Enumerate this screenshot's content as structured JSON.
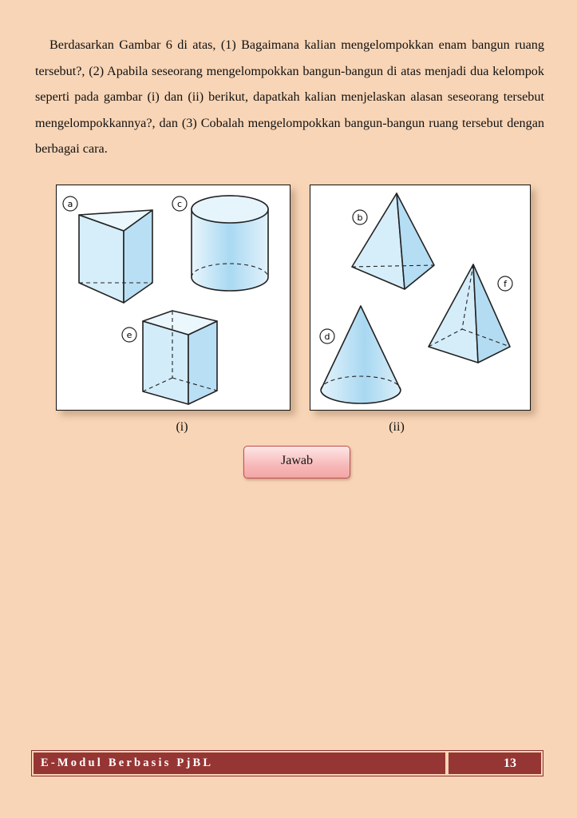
{
  "paragraph": "Berdasarkan Gambar 6 di atas, (1) Bagaimana kalian mengelompokkan enam bangun ruang tersebut?, (2) Apabila seseorang mengelompokkan bangun-bangun di atas menjadi dua kelompok seperti pada gambar (i) dan (ii) berikut, dapatkah kalian menjelaskan alasan seseorang tersebut mengelompokkannya?, dan (3) Cobalah mengelompokkan bangun-bangun ruang tersebut dengan berbagai cara.",
  "figure": {
    "group_i": {
      "caption": "(i)",
      "shapes": [
        {
          "label": "a",
          "name": "triangular-prism"
        },
        {
          "label": "c",
          "name": "cylinder"
        },
        {
          "label": "e",
          "name": "rectangular-prism"
        }
      ]
    },
    "group_ii": {
      "caption": "(ii)",
      "shapes": [
        {
          "label": "b",
          "name": "triangular-pyramid"
        },
        {
          "label": "f",
          "name": "square-pyramid"
        },
        {
          "label": "d",
          "name": "cone"
        }
      ]
    },
    "fill_color": "#cfe9f7",
    "stroke_color": "#222222"
  },
  "button": {
    "label": "Jawab",
    "border_color": "#c0504d"
  },
  "footer": {
    "title": "E-Modul Berbasis PjBL",
    "page_number": "13",
    "color": "#963634"
  }
}
